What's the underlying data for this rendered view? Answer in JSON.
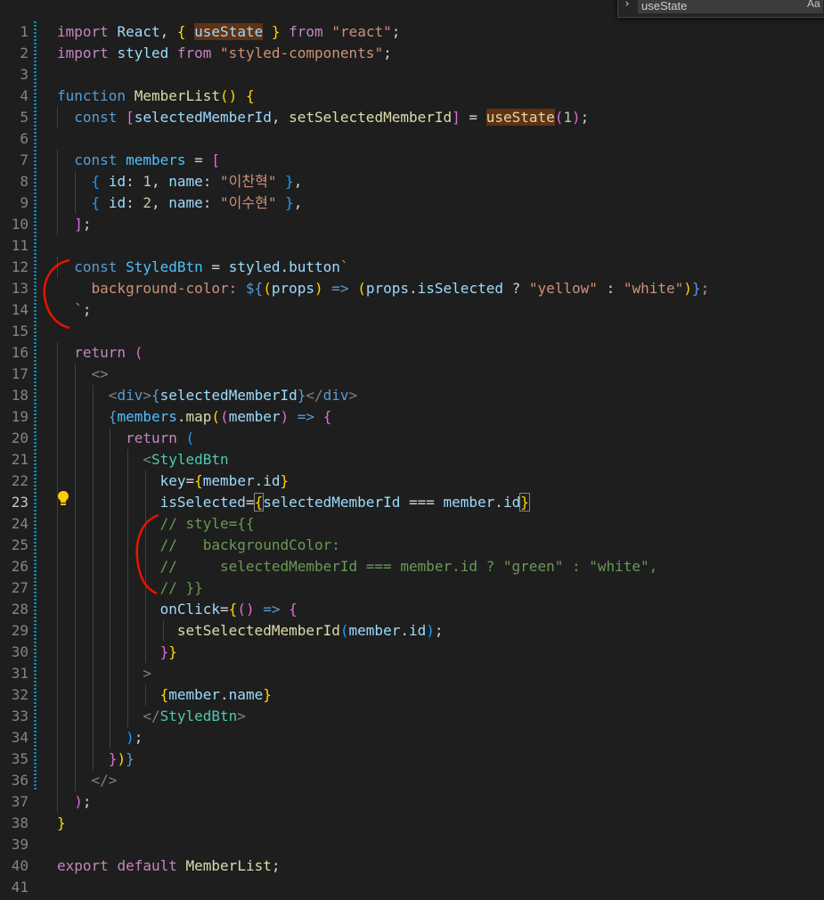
{
  "editor": {
    "language": "javascript",
    "active_line": 23,
    "lines": [
      [
        [
          "kw",
          "import"
        ],
        [
          "t",
          " "
        ],
        [
          "vr",
          "React"
        ],
        [
          "t",
          ", "
        ],
        [
          "b1",
          "{"
        ],
        [
          "t",
          " "
        ],
        [
          "vr hl",
          "useState"
        ],
        [
          "t",
          " "
        ],
        [
          "b1",
          "}"
        ],
        [
          "t",
          " "
        ],
        [
          "kw",
          "from"
        ],
        [
          "t",
          " "
        ],
        [
          "str",
          "\"react\""
        ],
        [
          "t",
          ";"
        ]
      ],
      [
        [
          "kw",
          "import"
        ],
        [
          "t",
          " "
        ],
        [
          "vr",
          "styled"
        ],
        [
          "t",
          " "
        ],
        [
          "kw",
          "from"
        ],
        [
          "t",
          " "
        ],
        [
          "str",
          "\"styled-components\""
        ],
        [
          "t",
          ";"
        ]
      ],
      [],
      [
        [
          "st",
          "function"
        ],
        [
          "t",
          " "
        ],
        [
          "fn",
          "MemberList"
        ],
        [
          "b1",
          "()"
        ],
        [
          "t",
          " "
        ],
        [
          "b1",
          "{"
        ]
      ],
      [
        [
          "t",
          "  "
        ],
        [
          "st",
          "const"
        ],
        [
          "t",
          " "
        ],
        [
          "b2",
          "["
        ],
        [
          "vr",
          "selectedMemberId"
        ],
        [
          "t",
          ", "
        ],
        [
          "fn",
          "setSelectedMemberId"
        ],
        [
          "b2",
          "]"
        ],
        [
          "t",
          " = "
        ],
        [
          "fn hl",
          "useState"
        ],
        [
          "b2",
          "("
        ],
        [
          "num",
          "1"
        ],
        [
          "b2",
          ")"
        ],
        [
          "t",
          ";"
        ]
      ],
      [],
      [
        [
          "t",
          "  "
        ],
        [
          "st",
          "const"
        ],
        [
          "t",
          " "
        ],
        [
          "cn",
          "members"
        ],
        [
          "t",
          " = "
        ],
        [
          "b2",
          "["
        ]
      ],
      [
        [
          "t",
          "    "
        ],
        [
          "b3",
          "{"
        ],
        [
          "t",
          " "
        ],
        [
          "vr",
          "id"
        ],
        [
          "t",
          ": "
        ],
        [
          "num",
          "1"
        ],
        [
          "t",
          ", "
        ],
        [
          "vr",
          "name"
        ],
        [
          "t",
          ": "
        ],
        [
          "str",
          "\"이찬혁\""
        ],
        [
          "t",
          " "
        ],
        [
          "b3",
          "}"
        ],
        [
          "t",
          ","
        ]
      ],
      [
        [
          "t",
          "    "
        ],
        [
          "b3",
          "{"
        ],
        [
          "t",
          " "
        ],
        [
          "vr",
          "id"
        ],
        [
          "t",
          ": "
        ],
        [
          "num",
          "2"
        ],
        [
          "t",
          ", "
        ],
        [
          "vr",
          "name"
        ],
        [
          "t",
          ": "
        ],
        [
          "str",
          "\"이수현\""
        ],
        [
          "t",
          " "
        ],
        [
          "b3",
          "}"
        ],
        [
          "t",
          ","
        ]
      ],
      [
        [
          "t",
          "  "
        ],
        [
          "b2",
          "]"
        ],
        [
          "t",
          ";"
        ]
      ],
      [],
      [
        [
          "t",
          "  "
        ],
        [
          "st",
          "const"
        ],
        [
          "t",
          " "
        ],
        [
          "cn",
          "StyledBtn"
        ],
        [
          "t",
          " = "
        ],
        [
          "vr",
          "styled"
        ],
        [
          "t",
          "."
        ],
        [
          "vr",
          "button"
        ],
        [
          "str",
          "`"
        ]
      ],
      [
        [
          "str",
          "    background-color: "
        ],
        [
          "st",
          "${"
        ],
        [
          "b1",
          "("
        ],
        [
          "vr",
          "props"
        ],
        [
          "b1",
          ")"
        ],
        [
          "t",
          " "
        ],
        [
          "st",
          "=>"
        ],
        [
          "t",
          " "
        ],
        [
          "b1",
          "("
        ],
        [
          "vr",
          "props"
        ],
        [
          "t",
          "."
        ],
        [
          "vr",
          "isSelected"
        ],
        [
          "t",
          " ? "
        ],
        [
          "str",
          "\"yellow\""
        ],
        [
          "t",
          " : "
        ],
        [
          "str",
          "\"white\""
        ],
        [
          "b1",
          ")"
        ],
        [
          "st",
          "}"
        ],
        [
          "str",
          ";"
        ]
      ],
      [
        [
          "str",
          "  `"
        ],
        [
          "t",
          ";"
        ]
      ],
      [],
      [
        [
          "t",
          "  "
        ],
        [
          "kw",
          "return"
        ],
        [
          "t",
          " "
        ],
        [
          "b2",
          "("
        ]
      ],
      [
        [
          "t",
          "    "
        ],
        [
          "pun",
          "<>"
        ]
      ],
      [
        [
          "t",
          "      "
        ],
        [
          "pun",
          "<"
        ],
        [
          "st",
          "div"
        ],
        [
          "pun",
          ">"
        ],
        [
          "st",
          "{"
        ],
        [
          "vr",
          "selectedMemberId"
        ],
        [
          "st",
          "}"
        ],
        [
          "pun",
          "</"
        ],
        [
          "st",
          "div"
        ],
        [
          "pun",
          ">"
        ]
      ],
      [
        [
          "t",
          "      "
        ],
        [
          "st",
          "{"
        ],
        [
          "cn",
          "members"
        ],
        [
          "t",
          "."
        ],
        [
          "fn",
          "map"
        ],
        [
          "b1",
          "("
        ],
        [
          "b2",
          "("
        ],
        [
          "vr",
          "member"
        ],
        [
          "b2",
          ")"
        ],
        [
          "t",
          " "
        ],
        [
          "st",
          "=>"
        ],
        [
          "t",
          " "
        ],
        [
          "b2",
          "{"
        ]
      ],
      [
        [
          "t",
          "        "
        ],
        [
          "kw",
          "return"
        ],
        [
          "t",
          " "
        ],
        [
          "b3",
          "("
        ]
      ],
      [
        [
          "t",
          "          "
        ],
        [
          "pun",
          "<"
        ],
        [
          "tag",
          "StyledBtn"
        ]
      ],
      [
        [
          "t",
          "            "
        ],
        [
          "vr",
          "key"
        ],
        [
          "t",
          "="
        ],
        [
          "b1",
          "{"
        ],
        [
          "vr",
          "member"
        ],
        [
          "t",
          "."
        ],
        [
          "vr",
          "id"
        ],
        [
          "b1",
          "}"
        ]
      ],
      [
        [
          "t",
          "            "
        ],
        [
          "vr",
          "isSelected"
        ],
        [
          "t",
          "="
        ],
        [
          "b1 match",
          "{"
        ],
        [
          "vr",
          "selectedMemberId"
        ],
        [
          "t",
          " === "
        ],
        [
          "vr",
          "member"
        ],
        [
          "t",
          "."
        ],
        [
          "vr",
          "id"
        ],
        [
          "b1 match",
          "}"
        ]
      ],
      [
        [
          "t",
          "            "
        ],
        [
          "cmt",
          "// style={{"
        ]
      ],
      [
        [
          "t",
          "            "
        ],
        [
          "cmt",
          "//   backgroundColor:"
        ]
      ],
      [
        [
          "t",
          "            "
        ],
        [
          "cmt",
          "//     selectedMemberId === member.id ? \"green\" : \"white\","
        ]
      ],
      [
        [
          "t",
          "            "
        ],
        [
          "cmt",
          "// }}"
        ]
      ],
      [
        [
          "t",
          "            "
        ],
        [
          "vr",
          "onClick"
        ],
        [
          "t",
          "="
        ],
        [
          "b1",
          "{"
        ],
        [
          "b2",
          "()"
        ],
        [
          "t",
          " "
        ],
        [
          "st",
          "=>"
        ],
        [
          "t",
          " "
        ],
        [
          "b2",
          "{"
        ]
      ],
      [
        [
          "t",
          "              "
        ],
        [
          "fn",
          "setSelectedMemberId"
        ],
        [
          "b3",
          "("
        ],
        [
          "vr",
          "member"
        ],
        [
          "t",
          "."
        ],
        [
          "vr",
          "id"
        ],
        [
          "b3",
          ")"
        ],
        [
          "t",
          ";"
        ]
      ],
      [
        [
          "t",
          "            "
        ],
        [
          "b2",
          "}"
        ],
        [
          "b1",
          "}"
        ]
      ],
      [
        [
          "t",
          "          "
        ],
        [
          "pun",
          ">"
        ]
      ],
      [
        [
          "t",
          "            "
        ],
        [
          "b1",
          "{"
        ],
        [
          "vr",
          "member"
        ],
        [
          "t",
          "."
        ],
        [
          "vr",
          "name"
        ],
        [
          "b1",
          "}"
        ]
      ],
      [
        [
          "t",
          "          "
        ],
        [
          "pun",
          "</"
        ],
        [
          "tag",
          "StyledBtn"
        ],
        [
          "pun",
          ">"
        ]
      ],
      [
        [
          "t",
          "        "
        ],
        [
          "b3",
          ")"
        ],
        [
          "t",
          ";"
        ]
      ],
      [
        [
          "t",
          "      "
        ],
        [
          "b2",
          "}"
        ],
        [
          "b1",
          ")"
        ],
        [
          "st",
          "}"
        ]
      ],
      [
        [
          "t",
          "    "
        ],
        [
          "pun",
          "</>"
        ]
      ],
      [
        [
          "t",
          "  "
        ],
        [
          "b2",
          ")"
        ],
        [
          "t",
          ";"
        ]
      ],
      [
        [
          "b1",
          "}"
        ]
      ],
      [],
      [
        [
          "kw",
          "export"
        ],
        [
          "t",
          " "
        ],
        [
          "kw",
          "default"
        ],
        [
          "t",
          " "
        ],
        [
          "fn",
          "MemberList"
        ],
        [
          "t",
          ";"
        ]
      ],
      []
    ]
  },
  "find": {
    "toggle_icon": "chevron-right-icon",
    "query": "useState",
    "match_case_label": "Aa"
  },
  "colors": {
    "background": "#1e1e1e",
    "line_number": "#858585",
    "highlight": "#613214",
    "annotation": "#e51400"
  }
}
